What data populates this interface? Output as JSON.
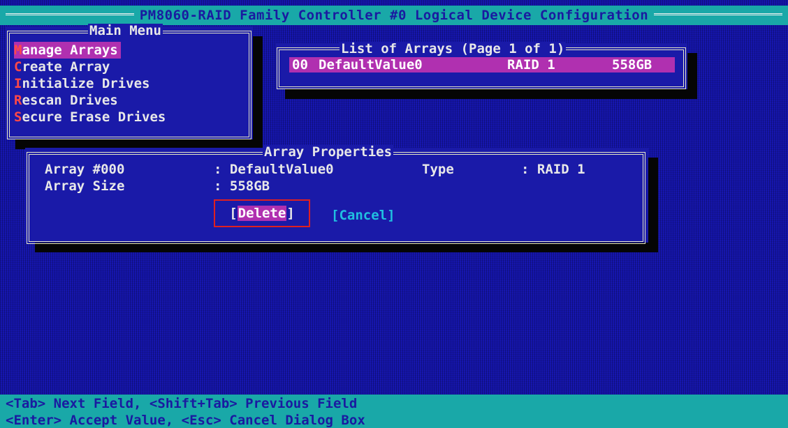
{
  "title": "PM8060-RAID Family Controller #0 Logical Device Configuration",
  "main_menu": {
    "title": "Main Menu",
    "items": [
      {
        "hot": "M",
        "rest": "anage Arrays"
      },
      {
        "hot": "C",
        "rest": "reate Array"
      },
      {
        "hot": "I",
        "rest": "nitialize Drives"
      },
      {
        "hot": "R",
        "rest": "escan Drives"
      },
      {
        "hot": "S",
        "rest": "ecure Erase Drives"
      }
    ]
  },
  "arrays_list": {
    "title": "List of Arrays (Page 1 of 1)",
    "rows": [
      {
        "index": "00",
        "name": "DefaultValue0",
        "raid": "RAID 1",
        "size": "558GB"
      }
    ]
  },
  "array_properties": {
    "title": "Array Properties",
    "array_label": "Array #000",
    "array_value": ": DefaultValue0",
    "type_label": "Type",
    "type_value": ": RAID 1",
    "size_label": "Array Size",
    "size_value": ": 558GB",
    "delete_open": "[",
    "delete_label": "Delete",
    "delete_close": "]",
    "cancel_label": "[Cancel]"
  },
  "footer": {
    "line1": "<Tab> Next Field, <Shift+Tab> Previous Field",
    "line2": "<Enter> Accept Value, <Esc> Cancel Dialog Box"
  },
  "colors": {
    "background": "#1616b0",
    "bar": "#19a8a8",
    "highlight": "#b030b0",
    "hotkey": "#ff4848",
    "cancel": "#20c0e0",
    "focus_outline": "#e02020"
  }
}
